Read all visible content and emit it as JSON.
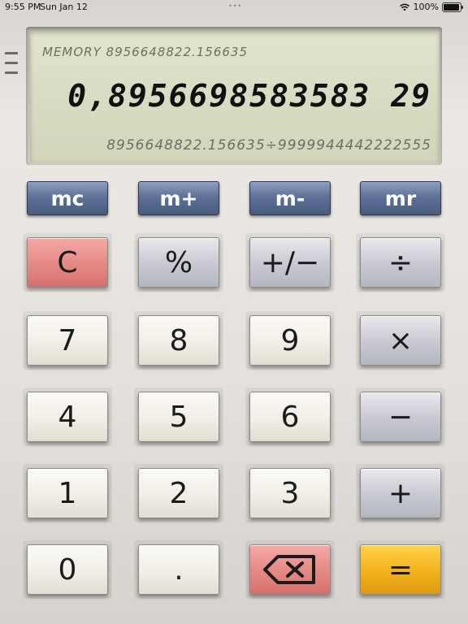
{
  "status_bar": {
    "time": "9:55 PM",
    "date": "Sun Jan 12",
    "battery": "100%"
  },
  "display": {
    "memory_label": "MEMORY",
    "memory_value": "8956648822.156635",
    "main_value": "0,8956698583583 29",
    "expression": "8956648822.156635÷9999944442222555"
  },
  "memory_keys": [
    "mc",
    "m+",
    "m-",
    "mr"
  ],
  "keys": {
    "clear": "C",
    "percent": "%",
    "plus_minus": "+/−",
    "divide": "÷",
    "seven": "7",
    "eight": "8",
    "nine": "9",
    "multiply": "×",
    "four": "4",
    "five": "5",
    "six": "6",
    "minus": "−",
    "one": "1",
    "two": "2",
    "three": "3",
    "plus": "+",
    "zero": "0",
    "decimal": ".",
    "backspace": "⌫",
    "equals": "="
  }
}
